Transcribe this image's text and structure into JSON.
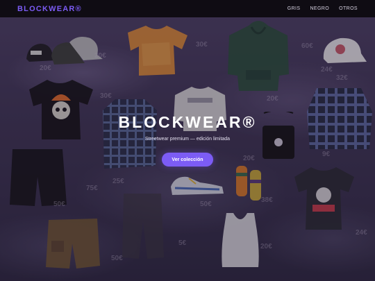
{
  "nav": {
    "logo": "BLOCKWEAR®",
    "links": [
      "GRIS",
      "NEGRO",
      "OTROS"
    ]
  },
  "hero": {
    "title": "BLOCKWEAR®",
    "subtitle": "Streetwear premium — edición limitada",
    "cta_label": "Ver colección"
  },
  "prices": [
    "20€",
    "20€",
    "30€",
    "60€",
    "24€",
    "30€",
    "20€",
    "20€",
    "9€",
    "25€",
    "75€",
    "50€",
    "50€",
    "38€",
    "5€",
    "20€",
    "50€",
    "24€",
    "32€"
  ],
  "colors": {
    "accent": "#7c5cf5",
    "navbar_bg": "#0f0c13",
    "hero_bg": "#3f3556"
  },
  "products": [
    "caps",
    "orange-tshirt",
    "green-hoodie",
    "white-cap",
    "black-skull-tshirt",
    "white-sweatshirt",
    "plaid-shirt",
    "plaid-overshirt",
    "crossbody-bag",
    "black-shorts",
    "sneakers",
    "striped-socks",
    "graphic-tshirt",
    "brown-cargo-shorts",
    "grey-jogger",
    "tank-top"
  ]
}
